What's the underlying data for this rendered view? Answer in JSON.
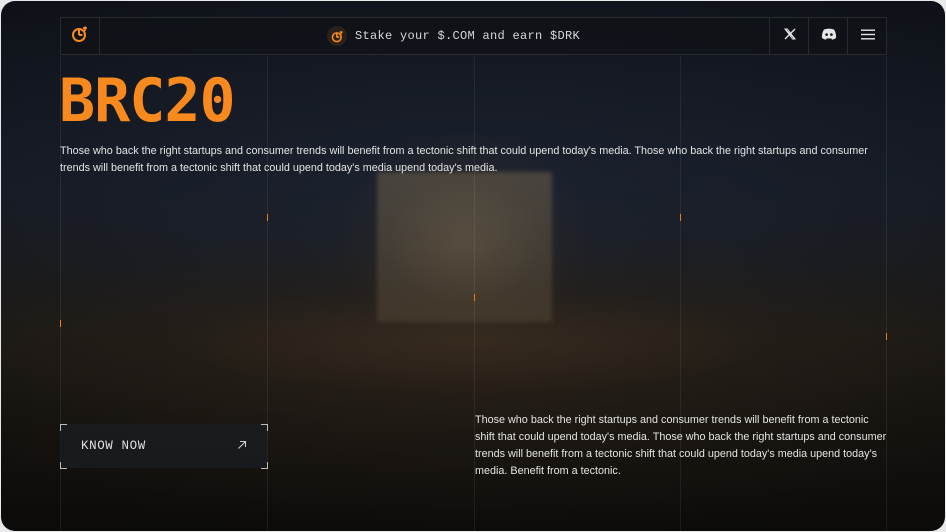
{
  "brand": {
    "logo_icon": "brand-logo-icon",
    "accent_color": "#f7891f"
  },
  "topbar": {
    "promo_text": "Stake your $.COM and earn $DRK",
    "promo_icon": "brand-badge-icon",
    "social": [
      {
        "icon": "x-twitter-icon"
      },
      {
        "icon": "discord-icon"
      }
    ],
    "menu_icon": "hamburger-menu-icon"
  },
  "hero": {
    "title": "BRC20",
    "intro": "Those who back the right startups and consumer trends will benefit from a tectonic shift that could upend today's media. Those who back the right startups and consumer trends will benefit from a tectonic shift that could upend today's media upend today's media.",
    "secondary": "Those who back the right startups and consumer trends will benefit from a tectonic shift that could upend today's media. Those who back the right startups and consumer trends will benefit from a tectonic shift that could upend today's media upend today's media. Benefit from a tectonic."
  },
  "cta": {
    "label": "KNOW NOW",
    "icon": "arrow-up-right-icon"
  }
}
